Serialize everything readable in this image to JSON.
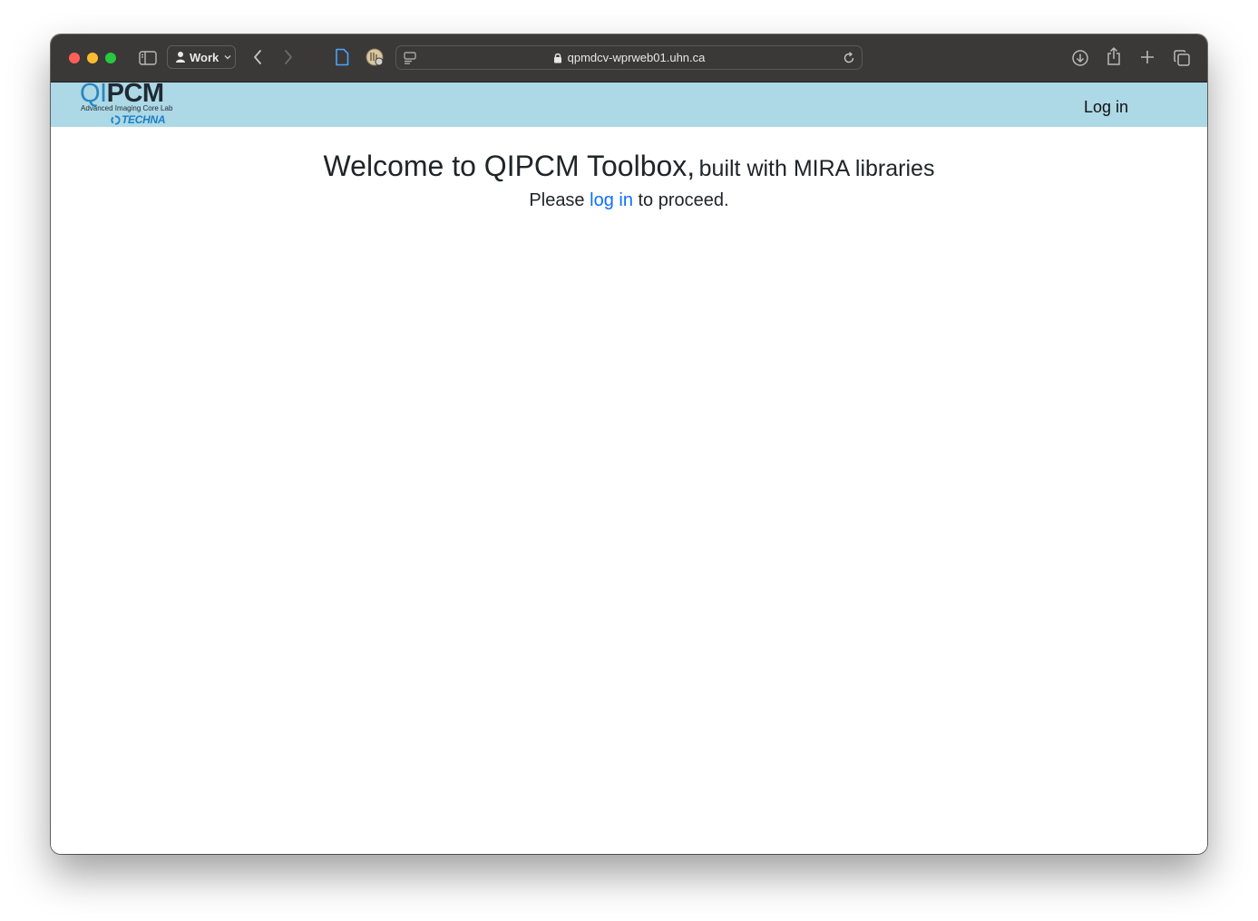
{
  "browser": {
    "profile_label": "Work",
    "url": "qpmdcv-wprweb01.uhn.ca"
  },
  "site": {
    "logo": {
      "qi": "QI",
      "pcm": "PCM",
      "subtitle": "Advanced Imaging Core Lab",
      "partner": "TECHNA"
    },
    "nav_login_label": "Log in"
  },
  "main": {
    "heading": "Welcome to QIPCM Toolbox,",
    "heading_suffix": "built with MIRA libraries",
    "proceed_prefix": "Please",
    "proceed_link": "log in",
    "proceed_suffix": "to proceed."
  },
  "colors": {
    "navbar_bg": "#add8e6",
    "link": "#0d6efd",
    "toolbar_bg": "#3a3938"
  }
}
